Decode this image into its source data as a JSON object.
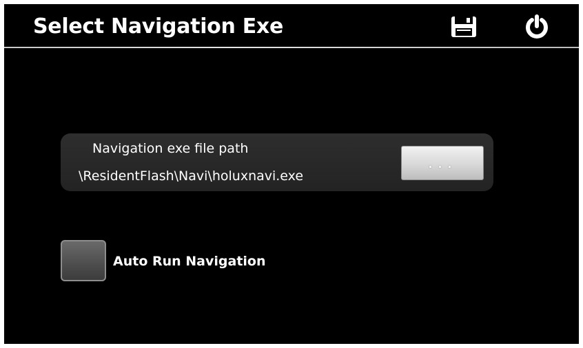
{
  "header": {
    "title": "Select Navigation Exe",
    "save_icon": "save-icon",
    "power_icon": "power-icon"
  },
  "path_panel": {
    "label": "Navigation exe file path",
    "value": "\\ResidentFlash\\Navi\\holuxnavi.exe",
    "browse_label": "...",
    "browse_icon": "ellipsis"
  },
  "auto_run": {
    "label": "Auto Run Navigation",
    "checked": false
  },
  "colors": {
    "background": "#000000",
    "text": "#ffffff",
    "panel": "#2a2a2a",
    "checkbox": "#555555"
  }
}
